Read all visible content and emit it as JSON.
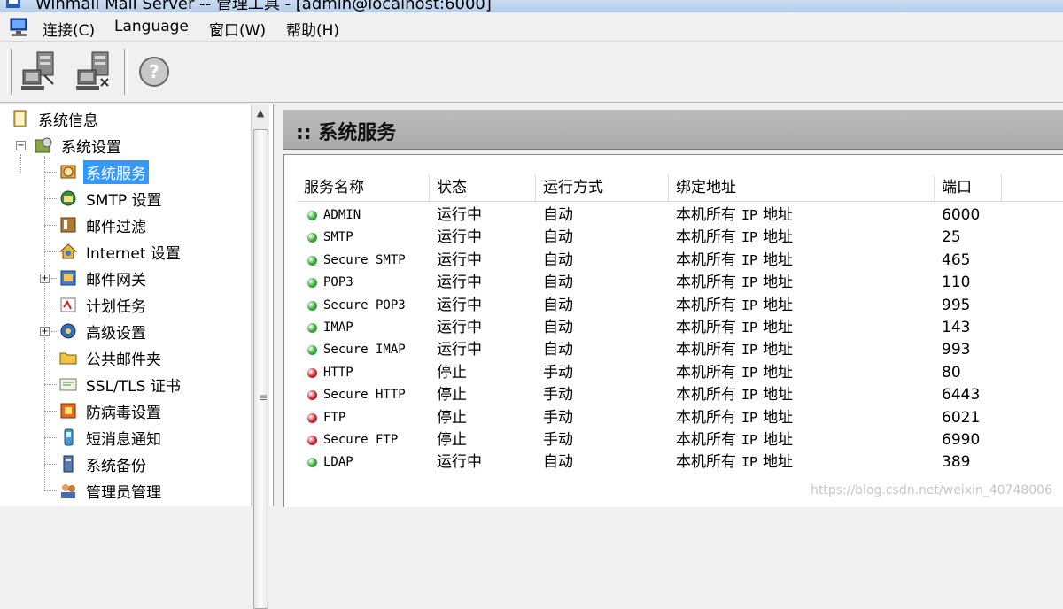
{
  "window": {
    "title": "Winmail Mail Server -- 管理工具 - [admin@localhost:6000]"
  },
  "menu": {
    "items": [
      "连接(C)",
      "Language",
      "窗口(W)",
      "帮助(H)"
    ]
  },
  "toolbar": {
    "buttons": [
      "connect-icon",
      "disconnect-icon",
      "help-icon"
    ]
  },
  "tree": {
    "items": [
      {
        "label": "系统信息",
        "icon": "book-icon",
        "level": 0
      },
      {
        "label": "系统设置",
        "icon": "settings-folder-icon",
        "level": 0,
        "expanded": true
      },
      {
        "label": "系统服务",
        "icon": "service-gear-icon",
        "level": 1,
        "selected": true
      },
      {
        "label": "SMTP 设置",
        "icon": "smtp-icon",
        "level": 1
      },
      {
        "label": "邮件过滤",
        "icon": "filter-icon",
        "level": 1
      },
      {
        "label": "Internet 设置",
        "icon": "internet-icon",
        "level": 1
      },
      {
        "label": "邮件网关",
        "icon": "gateway-icon",
        "level": 1,
        "collapsed": true
      },
      {
        "label": "计划任务",
        "icon": "schedule-icon",
        "level": 1
      },
      {
        "label": "高级设置",
        "icon": "advanced-icon",
        "level": 1,
        "collapsed": true
      },
      {
        "label": "公共邮件夹",
        "icon": "public-folder-icon",
        "level": 1
      },
      {
        "label": "SSL/TLS 证书",
        "icon": "certificate-icon",
        "level": 1
      },
      {
        "label": "防病毒设置",
        "icon": "antivirus-icon",
        "level": 1
      },
      {
        "label": "短消息通知",
        "icon": "sms-icon",
        "level": 1
      },
      {
        "label": "系统备份",
        "icon": "backup-icon",
        "level": 1
      },
      {
        "label": "管理员管理",
        "icon": "admin-icon",
        "level": 1
      }
    ]
  },
  "section": {
    "title": ":: 系统服务"
  },
  "table": {
    "columns": [
      "服务名称",
      "状态",
      "运行方式",
      "绑定地址",
      "端口"
    ],
    "rows": [
      {
        "name": "ADMIN",
        "status": "运行中",
        "mode": "自动",
        "addr_pre": "本机所有",
        "addr_ip": "IP",
        "addr_post": "地址",
        "port": "6000",
        "running": true
      },
      {
        "name": "SMTP",
        "status": "运行中",
        "mode": "自动",
        "addr_pre": "本机所有",
        "addr_ip": "IP",
        "addr_post": "地址",
        "port": "25",
        "running": true
      },
      {
        "name": "Secure SMTP",
        "status": "运行中",
        "mode": "自动",
        "addr_pre": "本机所有",
        "addr_ip": "IP",
        "addr_post": "地址",
        "port": "465",
        "running": true
      },
      {
        "name": "POP3",
        "status": "运行中",
        "mode": "自动",
        "addr_pre": "本机所有",
        "addr_ip": "IP",
        "addr_post": "地址",
        "port": "110",
        "running": true
      },
      {
        "name": "Secure POP3",
        "status": "运行中",
        "mode": "自动",
        "addr_pre": "本机所有",
        "addr_ip": "IP",
        "addr_post": "地址",
        "port": "995",
        "running": true
      },
      {
        "name": "IMAP",
        "status": "运行中",
        "mode": "自动",
        "addr_pre": "本机所有",
        "addr_ip": "IP",
        "addr_post": "地址",
        "port": "143",
        "running": true
      },
      {
        "name": "Secure IMAP",
        "status": "运行中",
        "mode": "自动",
        "addr_pre": "本机所有",
        "addr_ip": "IP",
        "addr_post": "地址",
        "port": "993",
        "running": true
      },
      {
        "name": "HTTP",
        "status": "停止",
        "mode": "手动",
        "addr_pre": "本机所有",
        "addr_ip": "IP",
        "addr_post": "地址",
        "port": "80",
        "running": false
      },
      {
        "name": "Secure HTTP",
        "status": "停止",
        "mode": "手动",
        "addr_pre": "本机所有",
        "addr_ip": "IP",
        "addr_post": "地址",
        "port": "6443",
        "running": false
      },
      {
        "name": "FTP",
        "status": "停止",
        "mode": "手动",
        "addr_pre": "本机所有",
        "addr_ip": "IP",
        "addr_post": "地址",
        "port": "6021",
        "running": false
      },
      {
        "name": "Secure FTP",
        "status": "停止",
        "mode": "手动",
        "addr_pre": "本机所有",
        "addr_ip": "IP",
        "addr_post": "地址",
        "port": "6990",
        "running": false
      },
      {
        "name": "LDAP",
        "status": "运行中",
        "mode": "自动",
        "addr_pre": "本机所有",
        "addr_ip": "IP",
        "addr_post": "地址",
        "port": "389",
        "running": true
      }
    ]
  },
  "colors": {
    "running": "#2ea82e",
    "stopped": "#c8202a",
    "selection": "#3399ff"
  },
  "watermark": "https://blog.csdn.net/weixin_40748006"
}
